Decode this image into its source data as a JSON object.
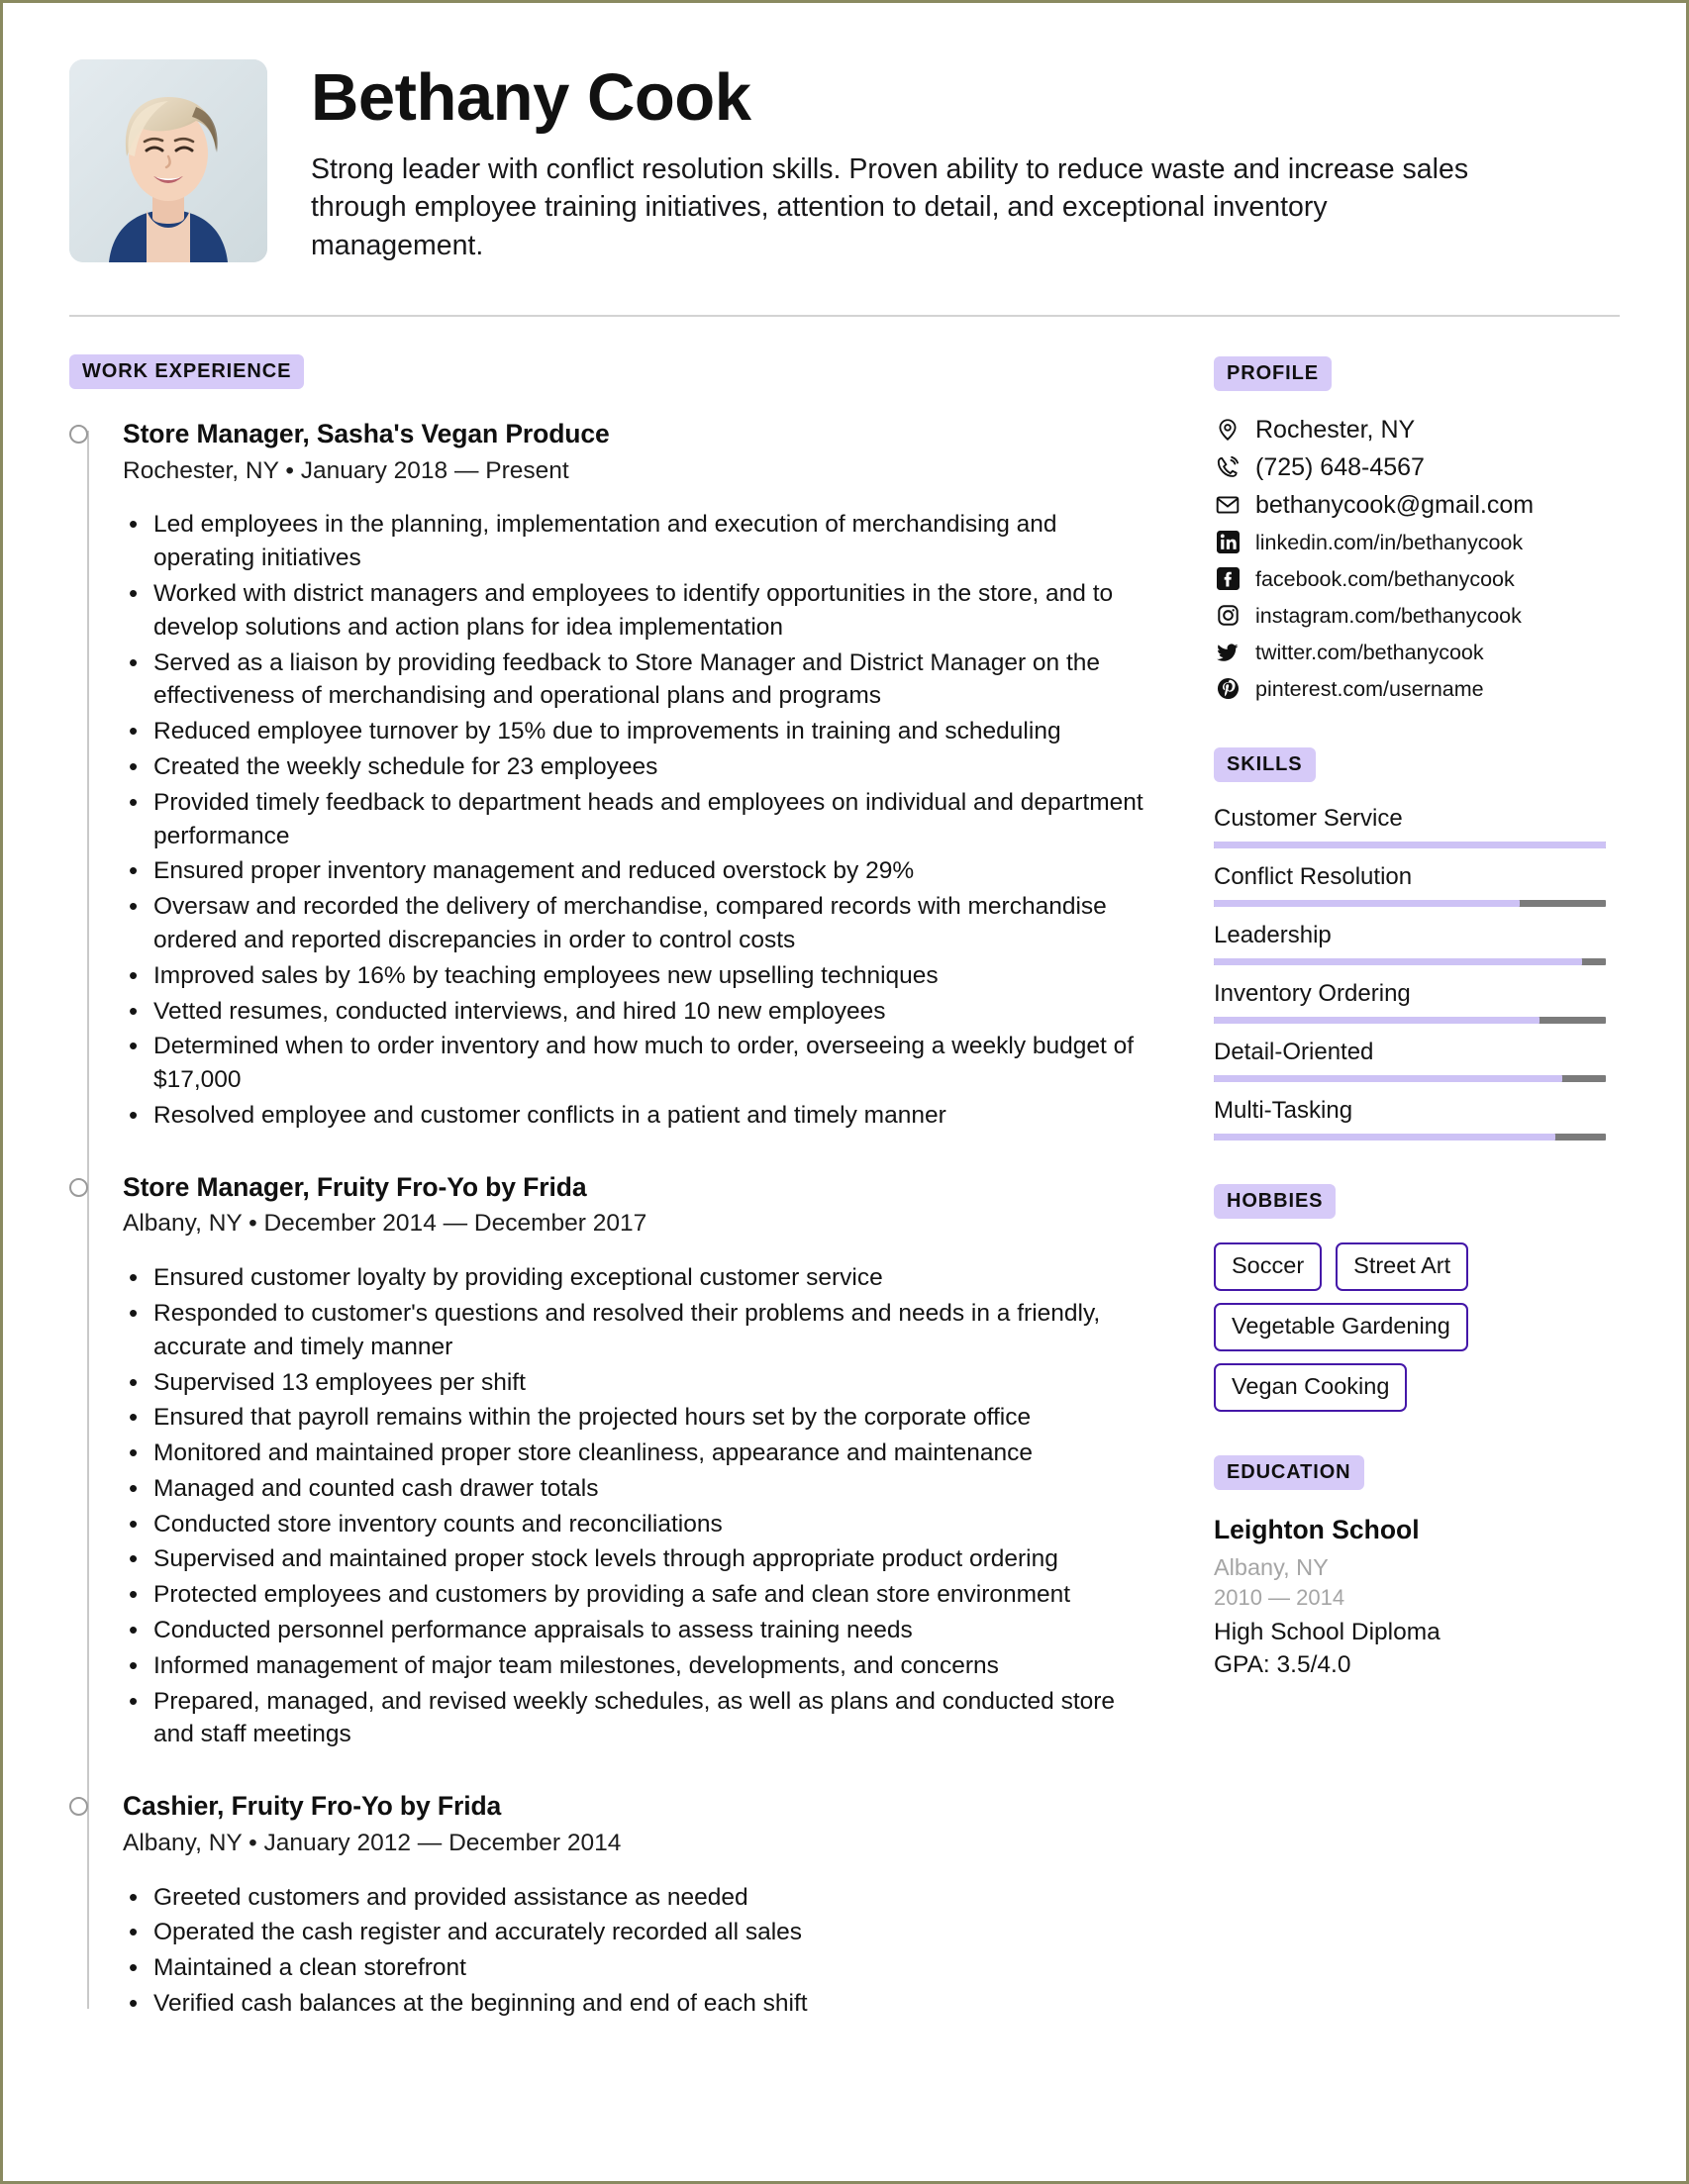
{
  "header": {
    "name": "Bethany Cook",
    "summary": "Strong leader with conflict resolution skills. Proven ability to reduce waste and increase sales through employee training initiatives, attention to detail, and exceptional inventory management.",
    "photo_alt": "profile-photo"
  },
  "colors": {
    "section_tag_bg": "#d6caf8",
    "skill_fill": "#cdc2f5",
    "skill_track": "#7b7b7b",
    "chip_border": "#4417a8",
    "timeline_line": "#c9c9c9",
    "divider": "#d3d3d3",
    "page_border": "#8a8a60"
  },
  "work": {
    "section_label": "WORK EXPERIENCE",
    "jobs": [
      {
        "title": "Store Manager, Sasha's Vegan Produce",
        "meta": "Rochester, NY • January 2018 — Present",
        "bullets": [
          "Led employees in the planning, implementation and execution of merchandising and operating initiatives",
          "Worked with district managers and employees to identify opportunities in the store, and to develop solutions and action plans for idea implementation",
          "Served as a liaison by providing feedback to Store Manager and District Manager on the effectiveness of merchandising and operational plans and programs",
          "Reduced employee turnover by 15% due to improvements in training and scheduling",
          "Created the weekly schedule for 23 employees",
          "Provided timely feedback to department heads and employees on individual and department performance",
          "Ensured proper inventory management and reduced overstock by 29%",
          "Oversaw and recorded the delivery of merchandise, compared records with merchandise ordered and reported discrepancies in order to control costs",
          "Improved sales by 16% by teaching employees new upselling techniques",
          "Vetted resumes, conducted interviews, and hired 10 new employees",
          "Determined when to order inventory and how much to order, overseeing a weekly budget of $17,000",
          "Resolved employee and customer conflicts in a patient and timely manner"
        ]
      },
      {
        "title": "Store Manager, Fruity Fro-Yo by Frida",
        "meta": "Albany, NY • December 2014 — December 2017",
        "bullets": [
          "Ensured customer loyalty by providing exceptional customer service",
          "Responded to customer's questions and resolved their problems and needs in a friendly, accurate and timely manner",
          "Supervised 13 employees per shift",
          "Ensured that payroll remains within the projected hours set by the corporate office",
          "Monitored and maintained proper store cleanliness, appearance and maintenance",
          "Managed and counted cash drawer totals",
          "Conducted store inventory counts and reconciliations",
          "Supervised and maintained proper stock levels through appropriate product ordering",
          "Protected employees and customers by providing a safe and clean store environment",
          "Conducted personnel performance appraisals to assess training needs",
          "Informed management of major team milestones, developments, and concerns",
          "Prepared, managed, and revised weekly schedules, as well as plans and conducted store and staff meetings"
        ]
      },
      {
        "title": "Cashier, Fruity Fro-Yo by Frida",
        "meta": "Albany, NY • January 2012 — December 2014",
        "bullets": [
          "Greeted customers and provided assistance as needed",
          "Operated the cash register and accurately recorded all sales",
          "Maintained a clean storefront",
          "Verified cash balances at the beginning and end of each shift"
        ]
      }
    ]
  },
  "profile": {
    "section_label": "PROFILE",
    "contacts": [
      {
        "icon": "location-pin-icon",
        "text": "Rochester, NY",
        "size": "lg"
      },
      {
        "icon": "phone-icon",
        "text": "(725) 648-4567",
        "size": "lg"
      },
      {
        "icon": "envelope-icon",
        "text": "bethanycook@gmail.com",
        "size": "lg"
      },
      {
        "icon": "linkedin-icon",
        "text": "linkedin.com/in/bethanycook",
        "size": "sm"
      },
      {
        "icon": "facebook-icon",
        "text": "facebook.com/bethanycook",
        "size": "sm"
      },
      {
        "icon": "instagram-icon",
        "text": "instagram.com/bethanycook",
        "size": "sm"
      },
      {
        "icon": "twitter-icon",
        "text": "twitter.com/bethanycook",
        "size": "sm"
      },
      {
        "icon": "pinterest-icon",
        "text": "pinterest.com/username",
        "size": "sm"
      }
    ]
  },
  "skills": {
    "section_label": "SKILLS",
    "items": [
      {
        "name": "Customer Service",
        "level": 100
      },
      {
        "name": "Conflict Resolution",
        "level": 78
      },
      {
        "name": "Leadership",
        "level": 94
      },
      {
        "name": "Inventory Ordering",
        "level": 83
      },
      {
        "name": "Detail-Oriented",
        "level": 89
      },
      {
        "name": "Multi-Tasking",
        "level": 87
      }
    ]
  },
  "hobbies": {
    "section_label": "HOBBIES",
    "items": [
      "Soccer",
      "Street Art",
      "Vegetable Gardening",
      "Vegan Cooking"
    ]
  },
  "education": {
    "section_label": "EDUCATION",
    "school": "Leighton School",
    "location": "Albany, NY",
    "years": "2010 — 2014",
    "degree": "High School Diploma",
    "gpa": "GPA: 3.5/4.0"
  }
}
